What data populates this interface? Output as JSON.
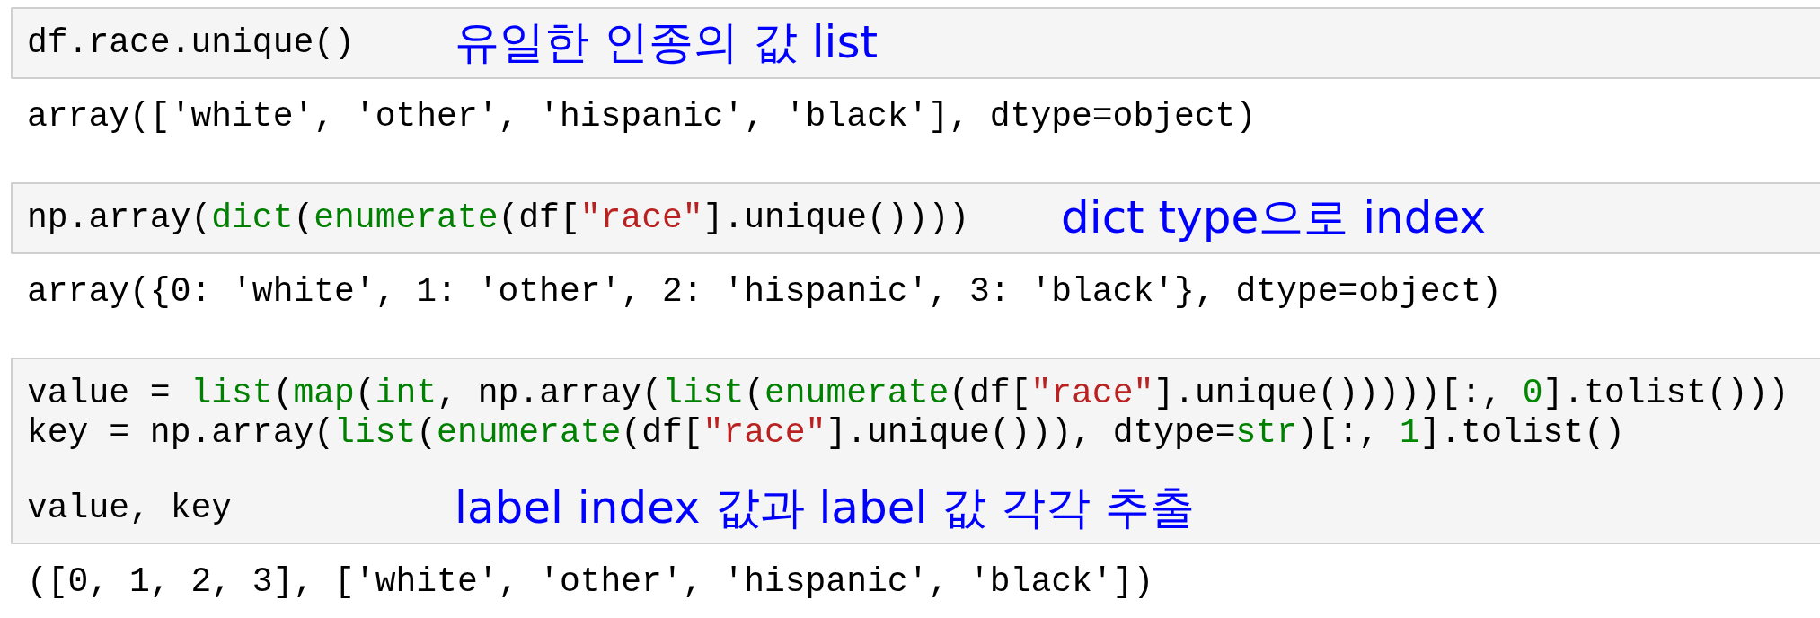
{
  "cells": [
    {
      "input": {
        "lines": [
          {
            "spaced_above": false,
            "tokens": [
              {
                "kind": "plain",
                "text": "df.race.unique()"
              }
            ]
          }
        ]
      },
      "annotation": "유일한 인종의 값 list",
      "output": "array(['white', 'other', 'hispanic', 'black'], dtype=object)"
    },
    {
      "input": {
        "lines": [
          {
            "spaced_above": false,
            "tokens": [
              {
                "kind": "plain",
                "text": "np.array("
              },
              {
                "kind": "builtin",
                "text": "dict"
              },
              {
                "kind": "plain",
                "text": "("
              },
              {
                "kind": "builtin",
                "text": "enumerate"
              },
              {
                "kind": "plain",
                "text": "(df["
              },
              {
                "kind": "string",
                "text": "\"race\""
              },
              {
                "kind": "plain",
                "text": "].unique())))"
              }
            ]
          }
        ]
      },
      "annotation": "dict type으로 index",
      "output": "array({0: 'white', 1: 'other', 2: 'hispanic', 3: 'black'}, dtype=object)"
    },
    {
      "input": {
        "lines": [
          {
            "spaced_above": false,
            "tokens": [
              {
                "kind": "plain",
                "text": "value = "
              },
              {
                "kind": "builtin",
                "text": "list"
              },
              {
                "kind": "plain",
                "text": "("
              },
              {
                "kind": "builtin",
                "text": "map"
              },
              {
                "kind": "plain",
                "text": "("
              },
              {
                "kind": "builtin",
                "text": "int"
              },
              {
                "kind": "plain",
                "text": ", np.array("
              },
              {
                "kind": "builtin",
                "text": "list"
              },
              {
                "kind": "plain",
                "text": "("
              },
              {
                "kind": "builtin",
                "text": "enumerate"
              },
              {
                "kind": "plain",
                "text": "(df["
              },
              {
                "kind": "string",
                "text": "\"race\""
              },
              {
                "kind": "plain",
                "text": "].unique()))))[:, "
              },
              {
                "kind": "number",
                "text": "0"
              },
              {
                "kind": "plain",
                "text": "].tolist()))"
              }
            ]
          },
          {
            "spaced_above": false,
            "tokens": [
              {
                "kind": "plain",
                "text": "key = np.array("
              },
              {
                "kind": "builtin",
                "text": "list"
              },
              {
                "kind": "plain",
                "text": "("
              },
              {
                "kind": "builtin",
                "text": "enumerate"
              },
              {
                "kind": "plain",
                "text": "(df["
              },
              {
                "kind": "string",
                "text": "\"race\""
              },
              {
                "kind": "plain",
                "text": "].unique())), dtype="
              },
              {
                "kind": "builtin",
                "text": "str"
              },
              {
                "kind": "plain",
                "text": ")[:, "
              },
              {
                "kind": "number",
                "text": "1"
              },
              {
                "kind": "plain",
                "text": "].tolist()"
              }
            ]
          },
          {
            "spaced_above": true,
            "tokens": [
              {
                "kind": "plain",
                "text": "value, key"
              }
            ]
          }
        ]
      },
      "annotation": "label index 값과 label 값 각각 추출",
      "output": "([0, 1, 2, 3], ['white', 'other', 'hispanic', 'black'])"
    }
  ]
}
